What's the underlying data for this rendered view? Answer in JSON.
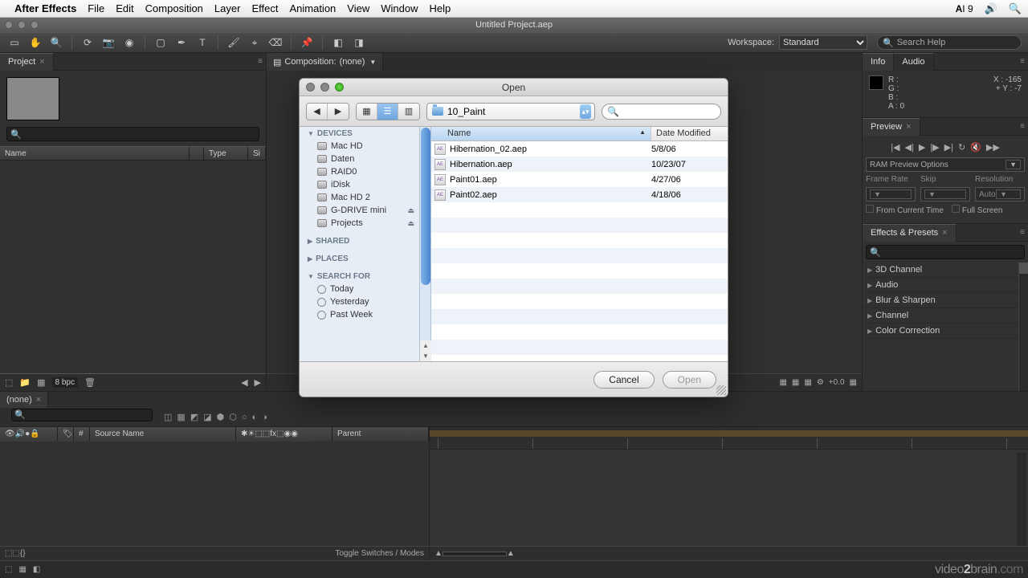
{
  "menubar": {
    "app": "After Effects",
    "items": [
      "File",
      "Edit",
      "Composition",
      "Layer",
      "Effect",
      "Animation",
      "View",
      "Window",
      "Help"
    ],
    "right_txt": "9"
  },
  "window": {
    "title": "Untitled Project.aep"
  },
  "workspace": {
    "label": "Workspace:",
    "value": "Standard"
  },
  "searchhelp": {
    "placeholder": "Search Help"
  },
  "panels": {
    "project": {
      "tab": "Project",
      "cols": [
        "Name",
        "",
        "Type",
        "Si"
      ],
      "bpc": "8 bpc"
    },
    "composition": {
      "tab_prefix": "Composition: ",
      "tab_value": "(none)"
    },
    "info": {
      "tab": "Info",
      "tab2": "Audio",
      "r": "R :",
      "g": "G :",
      "b": "B :",
      "a": "A : 0",
      "x": "X : -165",
      "y": "Y : -7"
    },
    "preview": {
      "tab": "Preview",
      "ram": "RAM Preview Options",
      "cols": [
        "Frame Rate",
        "Skip",
        "Resolution"
      ],
      "auto": "Auto",
      "from": "From Current Time",
      "full": "Full Screen"
    },
    "effects": {
      "tab": "Effects & Presets",
      "items": [
        "3D Channel",
        "Audio",
        "Blur & Sharpen",
        "Channel",
        "Color Correction"
      ]
    }
  },
  "timeline": {
    "tab": "(none)",
    "cols_left_icons": "",
    "col_num": "#",
    "col_src": "Source Name",
    "col_parent": "Parent",
    "toggle": "Toggle Switches / Modes"
  },
  "status": {
    "brand_a": "video",
    "brand_b": "2",
    "brand_c": "brain",
    "brand_d": ".com"
  },
  "dialog": {
    "title": "Open",
    "path": "10_Paint",
    "sidebar": {
      "devices_h": "DEVICES",
      "devices": [
        "Mac HD",
        "Daten",
        "RAID0",
        "iDisk",
        "Mac HD 2",
        "G-DRIVE mini",
        "Projects"
      ],
      "shared_h": "SHARED",
      "places_h": "PLACES",
      "search_h": "SEARCH FOR",
      "search_items": [
        "Today",
        "Yesterday",
        "Past Week"
      ]
    },
    "col_name": "Name",
    "col_date": "Date Modified",
    "files": [
      {
        "name": "Hibernation_02.aep",
        "date": "5/8/06"
      },
      {
        "name": "Hibernation.aep",
        "date": "10/23/07"
      },
      {
        "name": "Paint01.aep",
        "date": "4/27/06"
      },
      {
        "name": "Paint02.aep",
        "date": "4/18/06"
      }
    ],
    "cancel": "Cancel",
    "open": "Open"
  }
}
